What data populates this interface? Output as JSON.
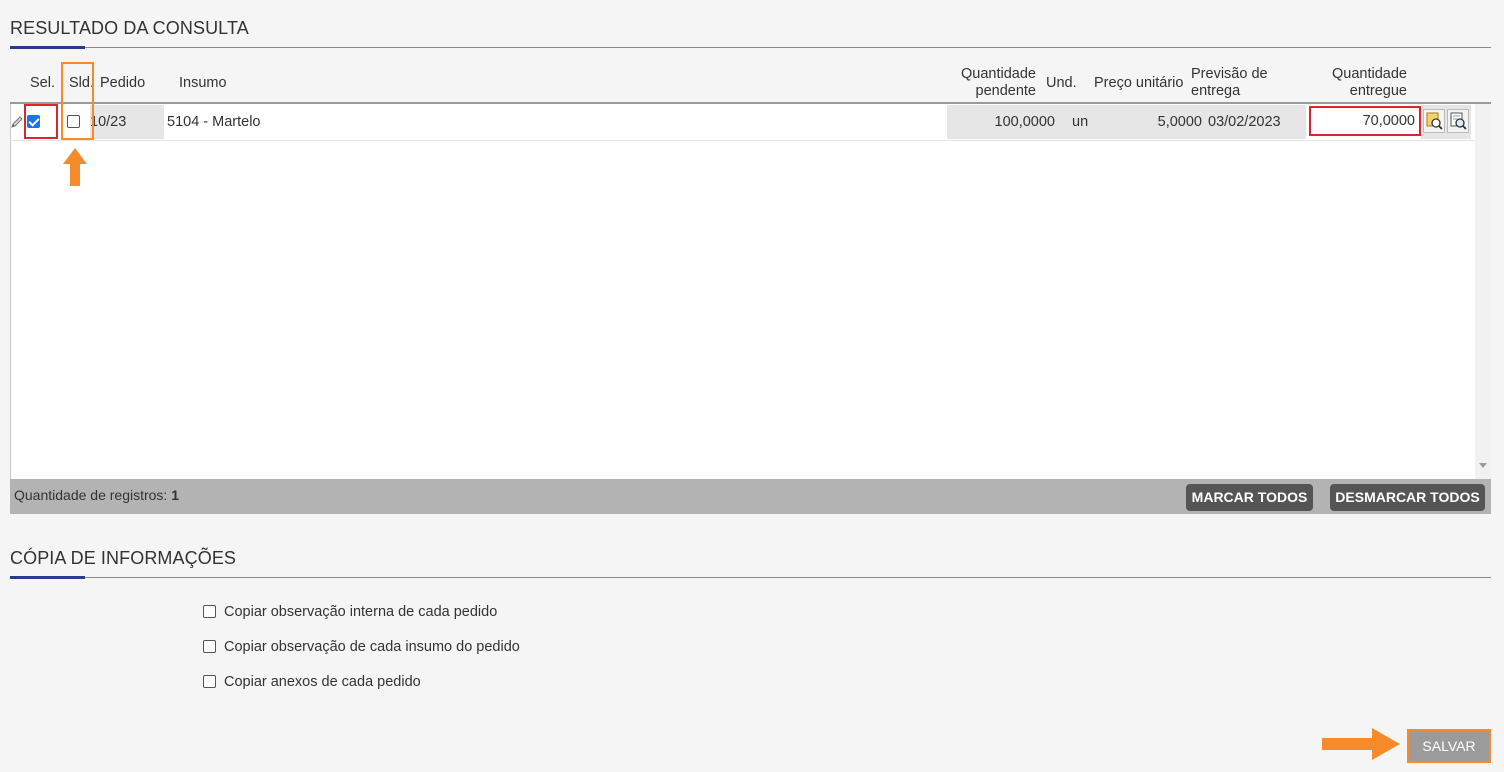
{
  "results_section": {
    "title": "RESULTADO DA CONSULTA"
  },
  "grid": {
    "headers": {
      "sel": "Sel.",
      "sld": "Sld.",
      "pedido": "Pedido",
      "insumo": "Insumo",
      "qtd_pendente_1": "Quantidade",
      "qtd_pendente_2": "pendente",
      "und": "Und.",
      "preco": "Preço unitário",
      "previsao_1": "Previsão de",
      "previsao_2": "entrega",
      "qtd_entregue_1": "Quantidade",
      "qtd_entregue_2": "entregue"
    },
    "rows": [
      {
        "sel_checked": true,
        "sld_checked": false,
        "pedido": "10/23",
        "insumo": "5104 - Martelo",
        "qtd_pendente": "100,0000",
        "und": "un",
        "preco": "5,0000",
        "previsao": "03/02/2023",
        "qtd_entregue": "70,0000"
      }
    ]
  },
  "footer": {
    "count_label": "Quantidade de registros:",
    "count_value": "1",
    "mark_all": "MARCAR TODOS",
    "unmark_all": "DESMARCAR TODOS"
  },
  "copy_section": {
    "title": "CÓPIA DE INFORMAÇÕES",
    "options": [
      {
        "label": "Copiar observação interna de cada pedido",
        "checked": false
      },
      {
        "label": "Copiar observação de cada insumo do pedido",
        "checked": false
      },
      {
        "label": "Copiar anexos de cada pedido",
        "checked": false
      }
    ]
  },
  "actions": {
    "save": "SALVAR"
  },
  "colors": {
    "accent": "#2a3a8c",
    "highlight_red": "#d9262c",
    "annotation_orange": "#f58b2b",
    "checkbox_checked": "#1a73e8"
  }
}
